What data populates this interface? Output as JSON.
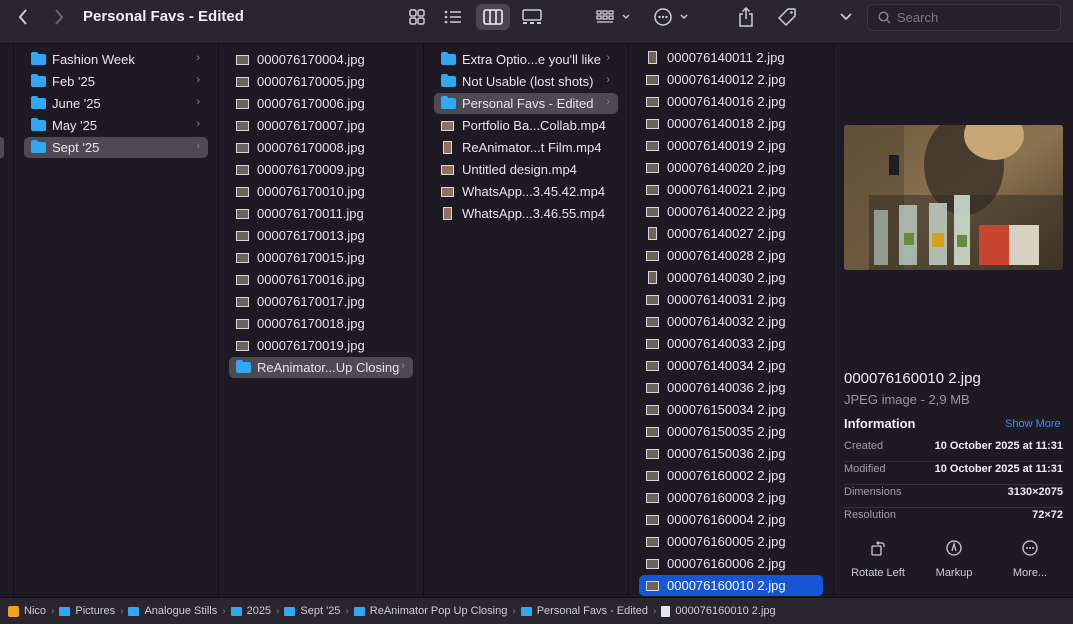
{
  "window": {
    "title": "Personal Favs - Edited"
  },
  "toolbar": {
    "search_placeholder": "Search",
    "icons": [
      "back-icon",
      "forward-icon",
      "icon-view-icon",
      "list-view-icon",
      "column-view-icon",
      "gallery-view-icon",
      "group-icon",
      "action-icon",
      "share-icon",
      "tag-icon",
      "more-chevron-icon",
      "search-icon"
    ]
  },
  "col1": {
    "items": [
      {
        "label": "Fashion Week"
      },
      {
        "label": "Feb '25"
      },
      {
        "label": "June '25"
      },
      {
        "label": "May '25"
      },
      {
        "label": "Sept '25"
      }
    ]
  },
  "col2": {
    "items": [
      {
        "label": "000076170004.jpg"
      },
      {
        "label": "000076170005.jpg"
      },
      {
        "label": "000076170006.jpg"
      },
      {
        "label": "000076170007.jpg"
      },
      {
        "label": "000076170008.jpg"
      },
      {
        "label": "000076170009.jpg"
      },
      {
        "label": "000076170010.jpg"
      },
      {
        "label": "000076170011.jpg"
      },
      {
        "label": "000076170013.jpg"
      },
      {
        "label": "000076170015.jpg"
      },
      {
        "label": "000076170016.jpg"
      },
      {
        "label": "000076170017.jpg"
      },
      {
        "label": "000076170018.jpg"
      },
      {
        "label": "000076170019.jpg"
      },
      {
        "label": "ReAnimator...Up Closing"
      }
    ]
  },
  "col3": {
    "items": [
      {
        "label": "Extra Optio...e you'll like"
      },
      {
        "label": "Not Usable (lost shots)"
      },
      {
        "label": "Personal Favs - Edited"
      },
      {
        "label": "Portfolio Ba...Collab.mp4"
      },
      {
        "label": "ReAnimator...t Film.mp4"
      },
      {
        "label": "Untitled design.mp4"
      },
      {
        "label": "WhatsApp...3.45.42.mp4"
      },
      {
        "label": "WhatsApp...3.46.55.mp4"
      }
    ]
  },
  "col4": {
    "items": [
      {
        "label": "000076140011 2.jpg"
      },
      {
        "label": "000076140012 2.jpg"
      },
      {
        "label": "000076140016 2.jpg"
      },
      {
        "label": "000076140018 2.jpg"
      },
      {
        "label": "000076140019 2.jpg"
      },
      {
        "label": "000076140020 2.jpg"
      },
      {
        "label": "000076140021 2.jpg"
      },
      {
        "label": "000076140022 2.jpg"
      },
      {
        "label": "000076140027 2.jpg"
      },
      {
        "label": "000076140028 2.jpg"
      },
      {
        "label": "000076140030 2.jpg"
      },
      {
        "label": "000076140031 2.jpg"
      },
      {
        "label": "000076140032 2.jpg"
      },
      {
        "label": "000076140033 2.jpg"
      },
      {
        "label": "000076140034 2.jpg"
      },
      {
        "label": "000076140036 2.jpg"
      },
      {
        "label": "000076150034 2.jpg"
      },
      {
        "label": "000076150035 2.jpg"
      },
      {
        "label": "000076150036 2.jpg"
      },
      {
        "label": "000076160002 2.jpg"
      },
      {
        "label": "000076160003 2.jpg"
      },
      {
        "label": "000076160004 2.jpg"
      },
      {
        "label": "000076160005 2.jpg"
      },
      {
        "label": "000076160006 2.jpg"
      },
      {
        "label": "000076160010 2.jpg"
      }
    ]
  },
  "preview": {
    "filename": "000076160010 2.jpg",
    "kind": "JPEG image - 2,9 MB",
    "info_heading": "Information",
    "show_more": "Show More",
    "rows": [
      {
        "key": "Created",
        "value": "10 October 2025 at 11:31"
      },
      {
        "key": "Modified",
        "value": "10 October 2025 at 11:31"
      },
      {
        "key": "Dimensions",
        "value": "3130×2075"
      },
      {
        "key": "Resolution",
        "value": "72×72"
      }
    ],
    "actions": [
      {
        "label": "Rotate Left"
      },
      {
        "label": "Markup"
      },
      {
        "label": "More..."
      }
    ]
  },
  "pathbar": {
    "crumbs": [
      {
        "label": "Nico"
      },
      {
        "label": "Pictures"
      },
      {
        "label": "Analogue Stills"
      },
      {
        "label": "2025"
      },
      {
        "label": "Sept '25"
      },
      {
        "label": "ReAnimator Pop Up Closing"
      },
      {
        "label": "Personal Favs - Edited"
      },
      {
        "label": "000076160010 2.jpg"
      }
    ]
  },
  "colors": {
    "accent": "#1656d6",
    "folder": "#31a8f4",
    "link": "#3d8ef7"
  }
}
